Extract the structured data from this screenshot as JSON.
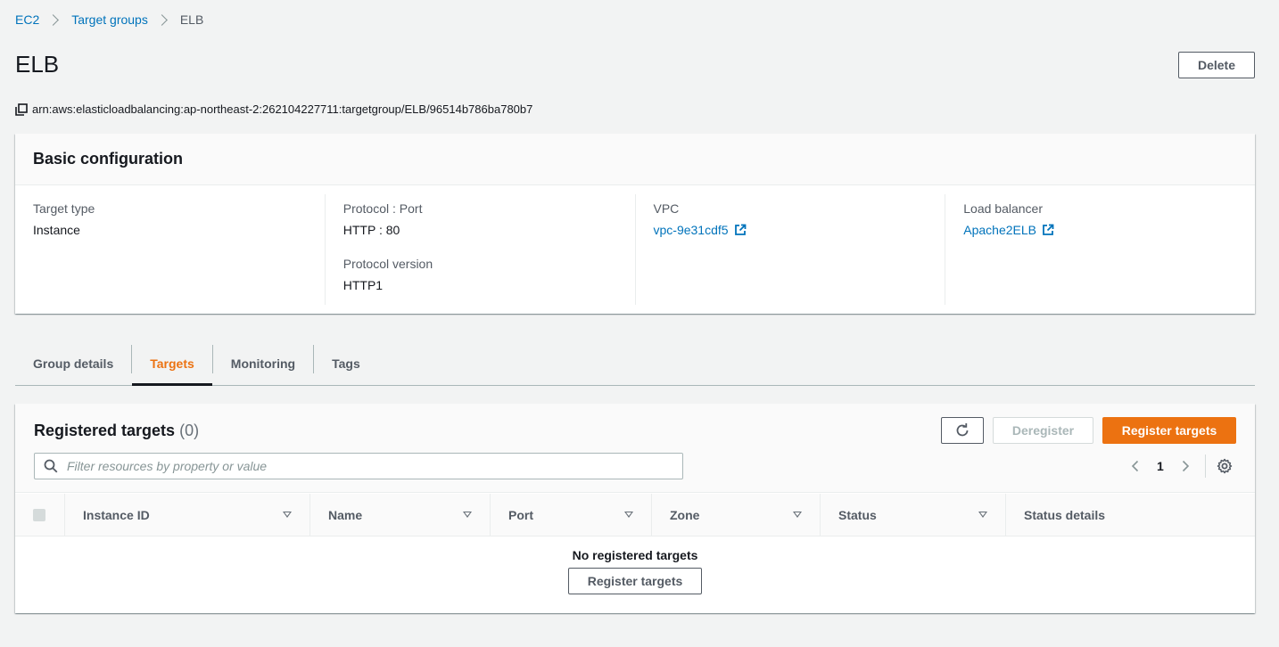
{
  "breadcrumb": {
    "items": [
      "EC2",
      "Target groups"
    ],
    "current": "ELB"
  },
  "header": {
    "title": "ELB",
    "delete_label": "Delete",
    "arn": "arn:aws:elasticloadbalancing:ap-northeast-2:262104227711:targetgroup/ELB/96514b786ba780b7"
  },
  "basic_config": {
    "title": "Basic configuration",
    "target_type_label": "Target type",
    "target_type_value": "Instance",
    "protocol_port_label": "Protocol : Port",
    "protocol_port_value": "HTTP : 80",
    "protocol_version_label": "Protocol version",
    "protocol_version_value": "HTTP1",
    "vpc_label": "VPC",
    "vpc_value": "vpc-9e31cdf5",
    "load_balancer_label": "Load balancer",
    "load_balancer_value": "Apache2ELB"
  },
  "tabs": [
    {
      "label": "Group details",
      "active": false
    },
    {
      "label": "Targets",
      "active": true
    },
    {
      "label": "Monitoring",
      "active": false
    },
    {
      "label": "Tags",
      "active": false
    }
  ],
  "targets": {
    "title": "Registered targets",
    "count": "(0)",
    "deregister_label": "Deregister",
    "register_label": "Register targets",
    "filter_placeholder": "Filter resources by property or value",
    "current_page": "1",
    "columns": [
      "Instance ID",
      "Name",
      "Port",
      "Zone",
      "Status",
      "Status details"
    ],
    "empty_text": "No registered targets",
    "empty_button_label": "Register targets"
  },
  "colors": {
    "accent": "#ec7211",
    "link": "#0073bb",
    "text": "#16191f",
    "muted": "#545b64",
    "background": "#f2f3f3"
  },
  "icons": {
    "breadcrumb_separator": "chevron-right-icon",
    "arn_copy": "copy-icon",
    "external_link": "external-link-icon",
    "refresh": "refresh-icon",
    "search": "search-icon",
    "previous": "chevron-left-icon",
    "next": "chevron-right-icon",
    "settings": "gear-icon",
    "sort": "caret-down-icon"
  }
}
